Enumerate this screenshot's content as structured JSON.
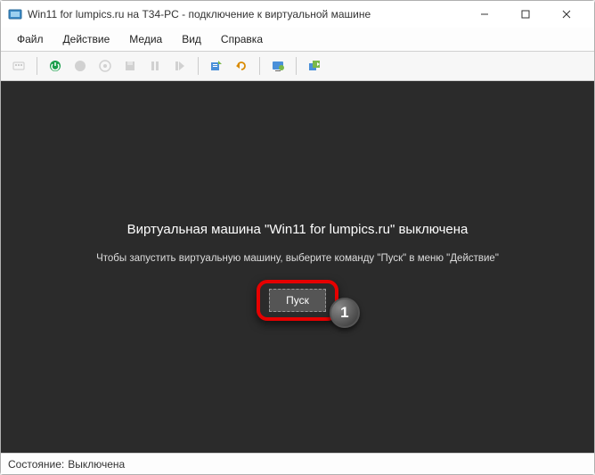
{
  "window": {
    "title": "Win11 for lumpics.ru на T34-PC - подключение к виртуальной машине"
  },
  "menu": {
    "file": "Файл",
    "action": "Действие",
    "media": "Медиа",
    "view": "Вид",
    "help": "Справка"
  },
  "content": {
    "heading": "Виртуальная машина \"Win11 for lumpics.ru\" выключена",
    "subtext": "Чтобы запустить виртуальную машину, выберите команду \"Пуск\" в меню \"Действие\"",
    "start_label": "Пуск"
  },
  "status": {
    "label": "Состояние:",
    "value": "Выключена"
  },
  "callout": {
    "number": "1"
  }
}
